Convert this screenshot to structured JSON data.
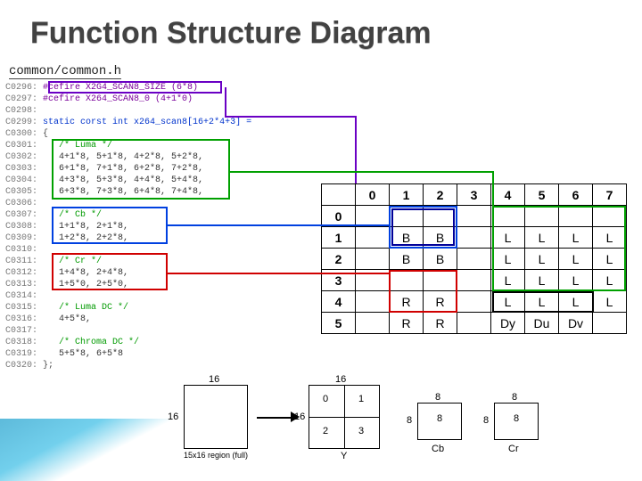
{
  "title": "Function Structure Diagram",
  "file": "common/common.h",
  "code_lines": [
    {
      "n": "C0296:",
      "t": "#cefire X2G4_SCAN8_SIZE (6*8)",
      "cls": "define"
    },
    {
      "n": "C0297:",
      "t": "#cefire X264_SCAN8_0 (4+1*0)",
      "cls": "define"
    },
    {
      "n": "C0298:",
      "t": "",
      "cls": ""
    },
    {
      "n": "C0299:",
      "t": "static corst int x264_scan8[16+2*4+3] =",
      "cls": "kw"
    },
    {
      "n": "C0300:",
      "t": "{",
      "cls": ""
    },
    {
      "n": "C0301:",
      "t": "   /* Luma */",
      "cls": "cm"
    },
    {
      "n": "C0302:",
      "t": "   4+1*8, 5+1*8, 4+2*8, 5+2*8,",
      "cls": "op"
    },
    {
      "n": "C0303:",
      "t": "   6+1*8, 7+1*8, 6+2*8, 7+2*8,",
      "cls": "op"
    },
    {
      "n": "C0304:",
      "t": "   4+3*8, 5+3*8, 4+4*8, 5+4*8,",
      "cls": "op"
    },
    {
      "n": "C0305:",
      "t": "   6+3*8, 7+3*8, 6+4*8, 7+4*8,",
      "cls": "op"
    },
    {
      "n": "C0306:",
      "t": "",
      "cls": ""
    },
    {
      "n": "C0307:",
      "t": "   /* Cb */",
      "cls": "cm"
    },
    {
      "n": "C0308:",
      "t": "   1+1*8, 2+1*8,",
      "cls": "op"
    },
    {
      "n": "C0309:",
      "t": "   1+2*8, 2+2*8,",
      "cls": "op"
    },
    {
      "n": "C0310:",
      "t": "",
      "cls": ""
    },
    {
      "n": "C0311:",
      "t": "   /* Cr */",
      "cls": "cm"
    },
    {
      "n": "C0312:",
      "t": "   1+4*8, 2+4*8,",
      "cls": "op"
    },
    {
      "n": "C0313:",
      "t": "   1+5*0, 2+5*0,",
      "cls": "op"
    },
    {
      "n": "C0314:",
      "t": "",
      "cls": ""
    },
    {
      "n": "C0315:",
      "t": "   /* Luma DC */",
      "cls": "cm"
    },
    {
      "n": "C0316:",
      "t": "   4+5*8,",
      "cls": "op"
    },
    {
      "n": "C0317:",
      "t": "",
      "cls": ""
    },
    {
      "n": "C0318:",
      "t": "   /* Chroma DC */",
      "cls": "cm"
    },
    {
      "n": "C0319:",
      "t": "   5+5*8, 6+5*8",
      "cls": "op"
    },
    {
      "n": "C0320:",
      "t": "};",
      "cls": ""
    }
  ],
  "grid": {
    "cols": [
      "0",
      "1",
      "2",
      "3",
      "4",
      "5",
      "6",
      "7"
    ],
    "rows": [
      {
        "h": "0",
        "c": [
          "",
          "",
          "",
          "",
          "",
          "",
          "",
          ""
        ]
      },
      {
        "h": "1",
        "c": [
          "",
          "B",
          "B",
          "",
          "L",
          "L",
          "L",
          "L"
        ]
      },
      {
        "h": "2",
        "c": [
          "",
          "B",
          "B",
          "",
          "L",
          "L",
          "L",
          "L"
        ]
      },
      {
        "h": "3",
        "c": [
          "",
          "",
          "",
          "",
          "L",
          "L",
          "L",
          "L"
        ]
      },
      {
        "h": "4",
        "c": [
          "",
          "R",
          "R",
          "",
          "L",
          "L",
          "L",
          "L"
        ]
      },
      {
        "h": "5",
        "c": [
          "",
          "R",
          "R",
          "",
          "Dy",
          "Du",
          "Dv",
          ""
        ]
      }
    ]
  },
  "bottom": {
    "big_region_label": "15x16 region (full)",
    "sixteen": "16",
    "eight": "8",
    "Y": "Y",
    "Cb": "Cb",
    "Cr": "Cr",
    "cells": [
      "0",
      "1",
      "2",
      "3",
      "8",
      "8",
      "8",
      "8"
    ]
  }
}
